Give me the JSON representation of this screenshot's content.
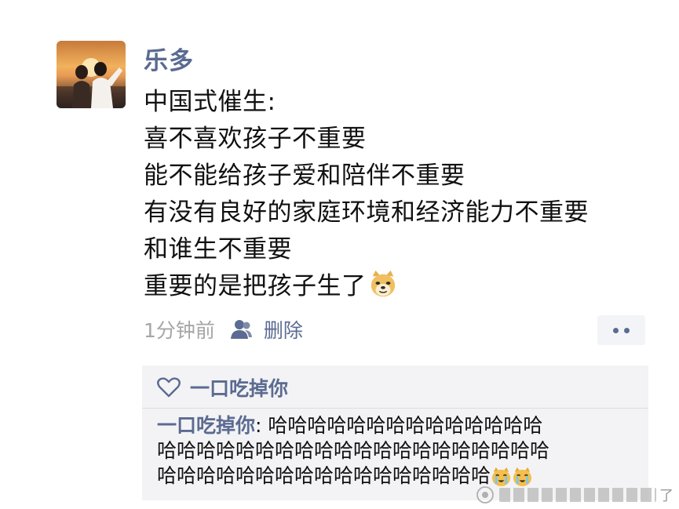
{
  "post": {
    "author": "乐多",
    "lines": [
      "中国式催生:",
      "喜不喜欢孩子不重要",
      "能不能给孩子爱和陪伴不重要",
      "有没有良好的家庭环境和经济能力不重要",
      "和谁生不重要",
      "重要的是把孩子生了"
    ],
    "emoji": "doge-emoji",
    "time": "1分钟前",
    "delete_label": "删除"
  },
  "likes": {
    "icon": "heart-icon",
    "names": "一口吃掉你"
  },
  "comment": {
    "author": "一口吃掉你",
    "separator": ": ",
    "line1": "哈哈哈哈哈哈哈哈哈哈哈哈哈哈",
    "line2": "哈哈哈哈哈哈哈哈哈哈哈哈哈哈哈哈哈哈哈哈",
    "line3": "哈哈哈哈哈哈哈哈哈哈哈哈哈哈哈哈哈",
    "emojis": [
      "laugh-cry-emoji",
      "laugh-cry-emoji"
    ]
  },
  "watermark": {
    "end_text": "了"
  },
  "colors": {
    "name_blue": "#5b6b91",
    "time_gray": "#a6a6a6",
    "comment_bg": "#f3f3f5"
  }
}
